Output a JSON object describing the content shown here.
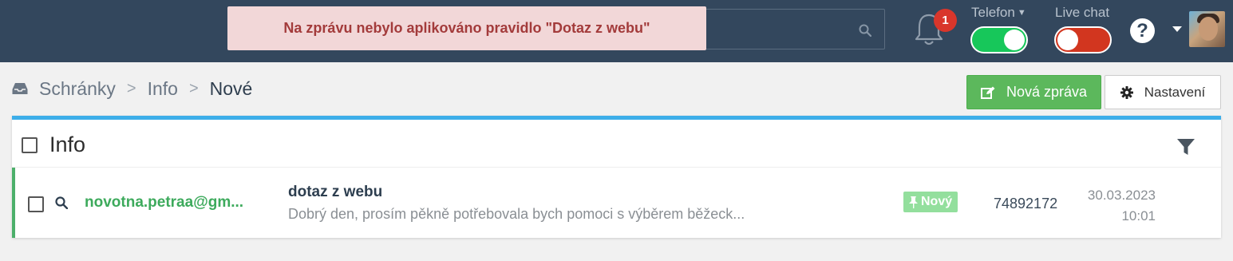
{
  "notification": {
    "message": "Na zprávu nebylo aplikováno pravidlo \"Dotaz z webu\""
  },
  "search": {
    "icon": "search-icon"
  },
  "bell": {
    "count": "1"
  },
  "telefon": {
    "label": "Telefon",
    "state": "on"
  },
  "livechat": {
    "label": "Live chat",
    "state": "off"
  },
  "help": {
    "glyph": "?"
  },
  "breadcrumb": {
    "items": [
      "Schránky",
      "Info",
      "Nové"
    ]
  },
  "toolbar": {
    "new_message": "Nová zpráva",
    "settings": "Nastavení"
  },
  "panel": {
    "title": "Info"
  },
  "messages": [
    {
      "sender": "novotna.petraa@gm...",
      "subject": "dotaz z webu",
      "preview": "Dobrý den, prosím pěkně potřebovala bych pomoci s výběrem běžeck...",
      "status": "Nový",
      "id": "74892172",
      "date": "30.03.2023",
      "time": "10:01"
    }
  ],
  "colors": {
    "topbar": "#33475d",
    "accent": "#3daee9",
    "success": "#5cb85c",
    "danger": "#d2361f"
  }
}
